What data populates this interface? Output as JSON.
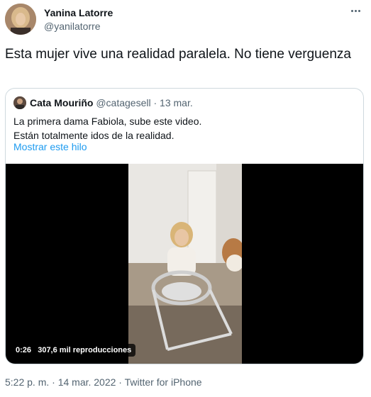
{
  "tweet": {
    "author": {
      "name": "Yanina Latorre",
      "handle": "@yanilatorre"
    },
    "text": "Esta mujer vive una realidad paralela. No  tiene verguenza",
    "timestamp": "5:22 p. m. · 14 mar. 2022 · Twitter for iPhone"
  },
  "quote": {
    "author_name": "Cata Mouriño",
    "meta": "@catagesell · 13 mar.",
    "lines": [
      "La primera dama Fabiola, sube este video.",
      "Están totalmente idos de la realidad."
    ],
    "show_thread": "Mostrar este hilo",
    "video": {
      "duration": "0:26",
      "views": "307,6 mil reproducciones"
    }
  },
  "colors": {
    "link": "#1d9bf0",
    "secondary_text": "#536471",
    "border": "#cfd9de"
  },
  "icons": [
    "more-options-icon"
  ]
}
